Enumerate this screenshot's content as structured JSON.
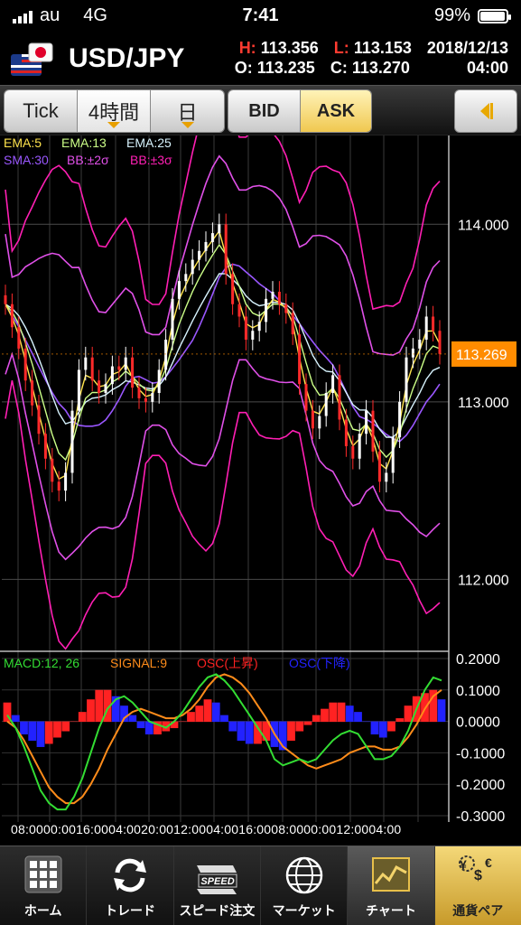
{
  "status_bar": {
    "carrier": "au",
    "network": "4G",
    "time": "7:41",
    "battery": "99%"
  },
  "header": {
    "pair": "USD/JPY",
    "high_key": "H:",
    "high": "113.356",
    "low_key": "L:",
    "low": "113.153",
    "open_key": "O:",
    "open": "113.235",
    "close_key": "C:",
    "close": "113.270",
    "date": "2018/12/13",
    "time": "04:00"
  },
  "toolbar": {
    "tabs": [
      {
        "label": "Tick",
        "has_dropdown": false
      },
      {
        "label": "4時間",
        "has_dropdown": true
      },
      {
        "label": "日",
        "has_dropdown": true
      }
    ],
    "bid_label": "BID",
    "ask_label": "ASK",
    "selected_price": "ASK",
    "collapse_icon": "chevron-left-icon"
  },
  "chart_data": [
    {
      "type": "candlestick",
      "legend": [
        "EMA:5",
        "EMA:13",
        "EMA:25",
        "SMA:30",
        "BB:±2σ",
        "BB:±3σ"
      ],
      "y_ticks": [
        "114.000",
        "113.000",
        "112.000"
      ],
      "current_price": "113.269",
      "ylim": [
        111.6,
        114.5
      ],
      "x_ticks": [
        "08:00",
        "00:00",
        "16:00",
        "04:00",
        "20:00",
        "12:00",
        "04:00",
        "16:00",
        "08:00",
        "00:00",
        "12:00",
        "04:00"
      ],
      "x_ticks_text": "08:0000:0016:0004:0020:0012:0004:0016:0008:0000:0012:0004:00",
      "colors": {
        "EMA:5": "#ffe44d",
        "EMA:13": "#ccff88",
        "EMA:25": "#d8f4ff",
        "SMA:30": "#9a57ff",
        "BB:±2σ": "#e050e8",
        "BB:±3σ": "#ff1fb4",
        "up": "#ffffff",
        "down": "#ff2a2a",
        "price_tag": "#ff8c00"
      },
      "close": [
        113.55,
        113.42,
        113.3,
        113.12,
        112.98,
        112.82,
        112.68,
        112.55,
        112.5,
        112.6,
        112.95,
        113.18,
        113.25,
        113.12,
        113.05,
        113.1,
        113.2,
        113.18,
        113.25,
        113.08,
        113.02,
        113.0,
        113.05,
        113.18,
        113.35,
        113.58,
        113.68,
        113.72,
        113.8,
        113.85,
        113.9,
        113.95,
        114.0,
        113.72,
        113.55,
        113.48,
        113.35,
        113.4,
        113.45,
        113.58,
        113.62,
        113.55,
        113.5,
        113.38,
        113.1,
        112.95,
        112.85,
        112.92,
        113.05,
        113.15,
        112.9,
        112.75,
        112.68,
        112.82,
        112.95,
        112.72,
        112.55,
        112.6,
        112.8,
        113.0,
        113.25,
        113.3,
        113.35,
        113.48,
        113.4,
        113.27
      ]
    },
    {
      "type": "line",
      "legend": [
        "MACD:12, 26",
        "SIGNAL:9",
        "OSC(上昇)",
        "OSC(下降)"
      ],
      "y_ticks": [
        "0.2000",
        "0.1000",
        "0.0000",
        "-0.1000",
        "-0.2000",
        "-0.3000"
      ],
      "ylim": [
        -0.32,
        0.22
      ],
      "colors": {
        "MACD:12, 26": "#33dd33",
        "SIGNAL:9": "#ff8c1a",
        "OSC(上昇)": "#ff2222",
        "OSC(下降)": "#2222ff"
      },
      "macd": [
        0.02,
        -0.02,
        -0.08,
        -0.15,
        -0.22,
        -0.26,
        -0.28,
        -0.28,
        -0.24,
        -0.18,
        -0.1,
        -0.02,
        0.04,
        0.07,
        0.08,
        0.06,
        0.03,
        0.0,
        -0.01,
        -0.02,
        0.0,
        0.03,
        0.07,
        0.11,
        0.14,
        0.15,
        0.13,
        0.1,
        0.06,
        0.02,
        -0.02,
        -0.06,
        -0.12,
        -0.14,
        -0.13,
        -0.12,
        -0.13,
        -0.12,
        -0.09,
        -0.06,
        -0.04,
        -0.03,
        -0.04,
        -0.08,
        -0.12,
        -0.12,
        -0.11,
        -0.08,
        -0.03,
        0.04,
        0.1,
        0.14,
        0.13
      ],
      "signal": [
        0.0,
        -0.02,
        -0.06,
        -0.11,
        -0.16,
        -0.21,
        -0.24,
        -0.26,
        -0.26,
        -0.24,
        -0.2,
        -0.15,
        -0.09,
        -0.04,
        0.01,
        0.03,
        0.04,
        0.03,
        0.02,
        0.01,
        0.01,
        0.02,
        0.04,
        0.07,
        0.11,
        0.14,
        0.15,
        0.14,
        0.12,
        0.09,
        0.05,
        0.01,
        -0.04,
        -0.08,
        -0.1,
        -0.12,
        -0.14,
        -0.15,
        -0.14,
        -0.13,
        -0.12,
        -0.1,
        -0.09,
        -0.08,
        -0.08,
        -0.09,
        -0.09,
        -0.08,
        -0.05,
        -0.01,
        0.04,
        0.08,
        0.1
      ],
      "osc": [
        0.06,
        0.02,
        -0.04,
        -0.06,
        -0.08,
        -0.07,
        -0.05,
        -0.03,
        0.0,
        0.03,
        0.07,
        0.1,
        0.1,
        0.08,
        0.05,
        0.02,
        -0.02,
        -0.04,
        -0.04,
        -0.03,
        -0.02,
        0.0,
        0.03,
        0.05,
        0.07,
        0.06,
        0.02,
        -0.03,
        -0.06,
        -0.07,
        -0.07,
        -0.06,
        -0.08,
        -0.09,
        -0.06,
        -0.03,
        -0.01,
        0.02,
        0.04,
        0.06,
        0.06,
        0.05,
        0.03,
        0.0,
        -0.04,
        -0.05,
        -0.03,
        0.01,
        0.05,
        0.08,
        0.09,
        0.1,
        0.07
      ]
    }
  ],
  "bottom_nav": [
    {
      "label": "ホーム",
      "icon": "grid-icon",
      "active": false
    },
    {
      "label": "トレード",
      "icon": "swap-arrows-icon",
      "active": false
    },
    {
      "label": "スピード注文",
      "icon": "speed-icon",
      "active": false
    },
    {
      "label": "マーケット",
      "icon": "globe-icon",
      "active": false
    },
    {
      "label": "チャート",
      "icon": "chart-icon",
      "active": true
    },
    {
      "label": "通貨ペア",
      "icon": "currency-icon",
      "active": false
    }
  ]
}
